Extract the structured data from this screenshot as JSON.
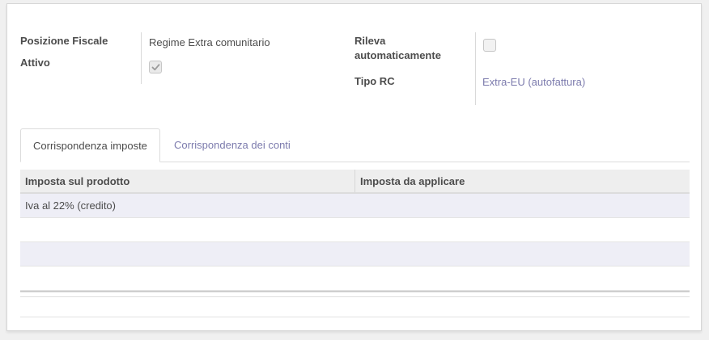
{
  "form": {
    "fiscal_position_label": "Posizione Fiscale",
    "fiscal_position_value": "Regime Extra comunitario",
    "active_label": "Attivo",
    "active_checked": true,
    "auto_detect_label_line1": "Rileva",
    "auto_detect_label_line2": "automaticamente",
    "auto_detect_checked": false,
    "rc_type_label": "Tipo RC",
    "rc_type_value": "Extra-EU (autofattura)"
  },
  "tabs": [
    {
      "label": "Corrispondenza imposte",
      "active": true
    },
    {
      "label": "Corrispondenza dei conti",
      "active": false
    }
  ],
  "table": {
    "columns": [
      "Imposta sul prodotto",
      "Imposta da applicare"
    ],
    "rows": [
      [
        "Iva al 22% (credito)",
        ""
      ],
      [
        "",
        ""
      ],
      [
        "",
        ""
      ],
      [
        "",
        ""
      ]
    ]
  },
  "colors": {
    "link": "#7c7bad",
    "odd_row": "#eeeef6",
    "header_bg": "#eeeeee"
  }
}
